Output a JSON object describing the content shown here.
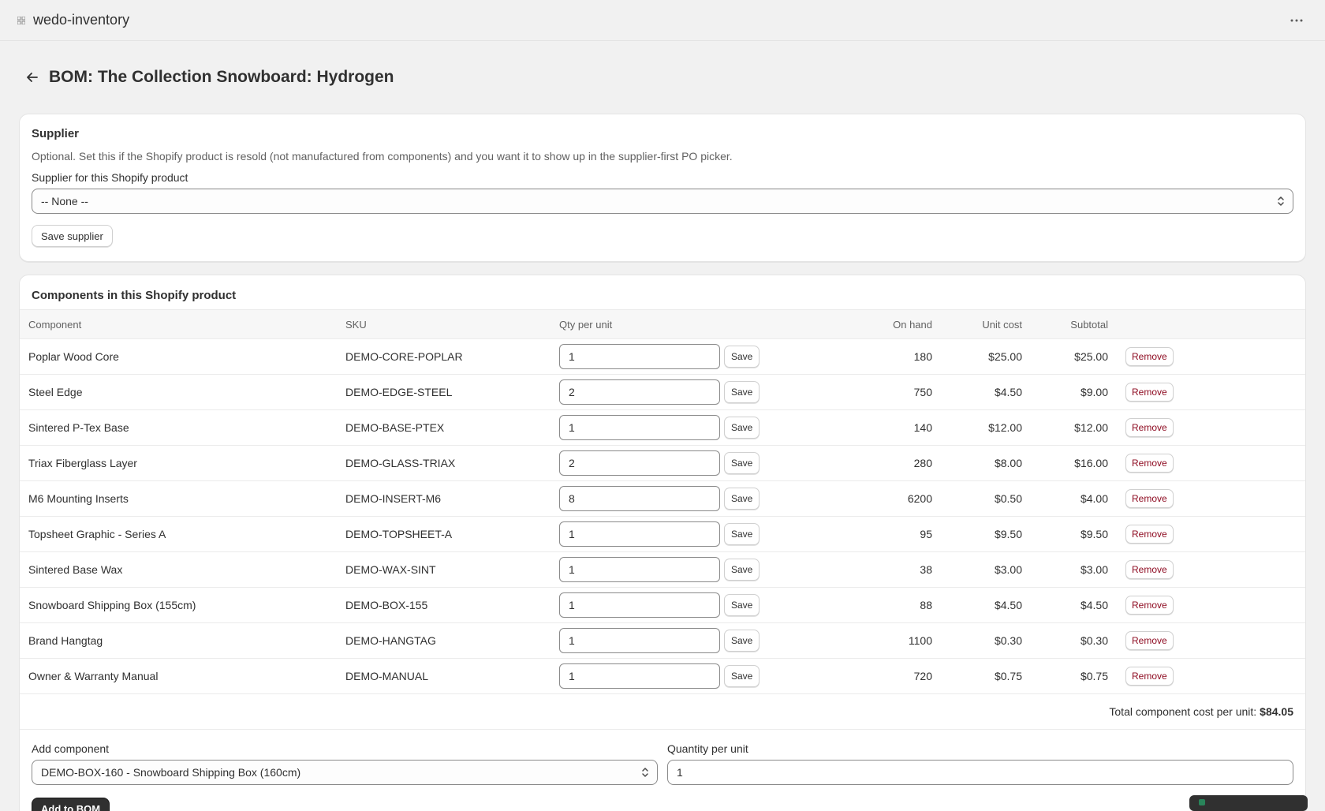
{
  "app": {
    "title": "wedo-inventory",
    "icon": "app-grid-icon",
    "more_icon": "more-horizontal-icon"
  },
  "page": {
    "title": "BOM: The Collection Snowboard: Hydrogen",
    "back_icon": "arrow-left-icon"
  },
  "supplier": {
    "heading": "Supplier",
    "help": "Optional. Set this if the Shopify product is resold (not manufactured from components) and you want it to show up in the supplier-first PO picker.",
    "field_label": "Supplier for this Shopify product",
    "selected": "-- None --",
    "save_label": "Save supplier"
  },
  "components": {
    "heading": "Components in this Shopify product",
    "columns": [
      "Component",
      "SKU",
      "Qty per unit",
      "On hand",
      "Unit cost",
      "Subtotal"
    ],
    "save_label": "Save",
    "remove_label": "Remove",
    "rows": [
      {
        "name": "Poplar Wood Core",
        "sku": "DEMO-CORE-POPLAR",
        "qty": "1",
        "on_hand": "180",
        "unit_cost": "$25.00",
        "subtotal": "$25.00"
      },
      {
        "name": "Steel Edge",
        "sku": "DEMO-EDGE-STEEL",
        "qty": "2",
        "on_hand": "750",
        "unit_cost": "$4.50",
        "subtotal": "$9.00"
      },
      {
        "name": "Sintered P-Tex Base",
        "sku": "DEMO-BASE-PTEX",
        "qty": "1",
        "on_hand": "140",
        "unit_cost": "$12.00",
        "subtotal": "$12.00"
      },
      {
        "name": "Triax Fiberglass Layer",
        "sku": "DEMO-GLASS-TRIAX",
        "qty": "2",
        "on_hand": "280",
        "unit_cost": "$8.00",
        "subtotal": "$16.00"
      },
      {
        "name": "M6 Mounting Inserts",
        "sku": "DEMO-INSERT-M6",
        "qty": "8",
        "on_hand": "6200",
        "unit_cost": "$0.50",
        "subtotal": "$4.00"
      },
      {
        "name": "Topsheet Graphic - Series A",
        "sku": "DEMO-TOPSHEET-A",
        "qty": "1",
        "on_hand": "95",
        "unit_cost": "$9.50",
        "subtotal": "$9.50"
      },
      {
        "name": "Sintered Base Wax",
        "sku": "DEMO-WAX-SINT",
        "qty": "1",
        "on_hand": "38",
        "unit_cost": "$3.00",
        "subtotal": "$3.00"
      },
      {
        "name": "Snowboard Shipping Box (155cm)",
        "sku": "DEMO-BOX-155",
        "qty": "1",
        "on_hand": "88",
        "unit_cost": "$4.50",
        "subtotal": "$4.50"
      },
      {
        "name": "Brand Hangtag",
        "sku": "DEMO-HANGTAG",
        "qty": "1",
        "on_hand": "1100",
        "unit_cost": "$0.30",
        "subtotal": "$0.30"
      },
      {
        "name": "Owner & Warranty Manual",
        "sku": "DEMO-MANUAL",
        "qty": "1",
        "on_hand": "720",
        "unit_cost": "$0.75",
        "subtotal": "$0.75"
      }
    ],
    "total_label": "Total component cost per unit:",
    "total_value": "$84.05"
  },
  "add": {
    "component_label": "Add component",
    "component_selected": "DEMO-BOX-160 - Snowboard Shipping Box (160cm)",
    "qty_label": "Quantity per unit",
    "qty_value": "1",
    "button_label": "Add to BOM"
  },
  "colors": {
    "primary_button": "#303030",
    "remove_text": "#8e0b21",
    "background": "#f1f1f1"
  }
}
